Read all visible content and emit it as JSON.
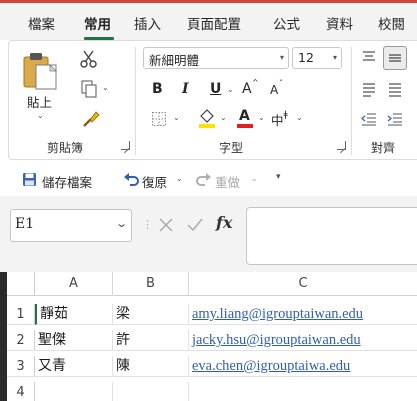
{
  "menu": {
    "tabs": [
      {
        "label": "檔案",
        "active": false
      },
      {
        "label": "常用",
        "active": true
      },
      {
        "label": "插入",
        "active": false
      },
      {
        "label": "頁面配置",
        "active": false
      },
      {
        "label": "公式",
        "active": false
      },
      {
        "label": "資料",
        "active": false
      },
      {
        "label": "校閱",
        "active": false
      }
    ]
  },
  "ribbon": {
    "clipboard": {
      "paste_label": "貼上",
      "group_label": "剪貼簿"
    },
    "font": {
      "font_name": "新細明體",
      "font_size": "12",
      "group_label": "字型",
      "bold": "B",
      "italic": "I",
      "underline": "U",
      "grow": "A",
      "shrink": "A",
      "phonetic": "中"
    },
    "alignment": {
      "group_label": "對齊"
    }
  },
  "qat": {
    "save_label": "儲存檔案",
    "undo_label": "復原",
    "redo_label": "重做"
  },
  "formula_bar": {
    "namebox": "E1",
    "fx": "fx"
  },
  "sheet": {
    "columns": [
      "A",
      "B",
      "C"
    ],
    "rows": [
      {
        "num": "1",
        "A": "靜茹",
        "B": "梁",
        "C": "amy.liang@igrouptaiwan.edu"
      },
      {
        "num": "2",
        "A": "聖傑",
        "B": "許",
        "C": "jacky.hsu@igrouptaiwan.edu"
      },
      {
        "num": "3",
        "A": "又青",
        "B": "陳",
        "C": "eva.chen@igrouptaiwa.edu"
      },
      {
        "num": "4",
        "A": "",
        "B": "",
        "C": ""
      }
    ]
  },
  "colors": {
    "accent": "#217346",
    "link": "#2f5fb3",
    "red_strip": "#d4453c",
    "font_color_red": "#e02020",
    "highlight_yellow": "#ffe100"
  }
}
